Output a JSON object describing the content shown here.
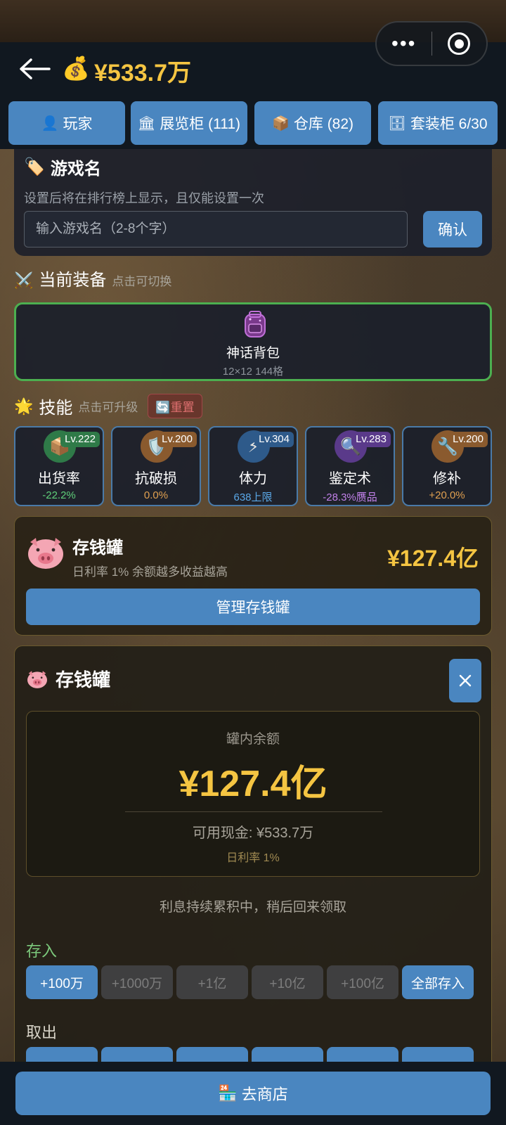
{
  "header": {
    "money_icon": "money-bag-icon",
    "money": "¥533.7万"
  },
  "tabs": [
    {
      "icon": "👤",
      "label": "玩家"
    },
    {
      "icon": "🏛",
      "label": "展览柜 (111)"
    },
    {
      "icon": "📦",
      "label": "仓库 (82)"
    },
    {
      "icon": "🗄",
      "label": "套装柜 6/30"
    }
  ],
  "name_card": {
    "icon": "🏷️",
    "title": "游戏名",
    "desc": "设置后将在排行榜上显示，且仅能设置一次",
    "input_placeholder": "输入游戏名（2-8个字）",
    "input_value": "",
    "confirm": "确认"
  },
  "equipment": {
    "icon": "⚔️",
    "title": "当前装备",
    "hint": "点击可切换",
    "item_name": "神话背包",
    "item_sub": "12×12 144格",
    "border_color": "#4caf50"
  },
  "skills_section": {
    "icon": "🌟",
    "title": "技能",
    "hint": "点击可升级",
    "reset": "🔄重置"
  },
  "skills": [
    {
      "icon": "box-icon",
      "glyph": "📦",
      "level": "Lv.222",
      "name": "出货率",
      "value": "-22.2%",
      "value_color": "#5fd07a",
      "icon_bg": "#2f7a48",
      "lv_bg": "#2f7a48"
    },
    {
      "icon": "shield-icon",
      "glyph": "🛡️",
      "level": "Lv.200",
      "name": "抗破损",
      "value": "0.0%",
      "value_color": "#e0a050",
      "icon_bg": "#8a5a2e",
      "lv_bg": "#8a5a2e"
    },
    {
      "icon": "lightning-icon",
      "glyph": "⚡",
      "level": "Lv.304",
      "name": "体力",
      "value": "638上限",
      "value_color": "#5aa8e8",
      "icon_bg": "#2e5a8a",
      "lv_bg": "#2e5a8a"
    },
    {
      "icon": "magnifier-icon",
      "glyph": "🔍",
      "level": "Lv.283",
      "name": "鉴定术",
      "value": "-28.3%赝品",
      "value_color": "#c080e8",
      "icon_bg": "#5a3a8a",
      "lv_bg": "#5a3a8a"
    },
    {
      "icon": "wrench-icon",
      "glyph": "🔧",
      "level": "Lv.200",
      "name": "修补",
      "value": "+20.0%",
      "value_color": "#e0a050",
      "icon_bg": "#8a5a2e",
      "lv_bg": "#8a5a2e"
    }
  ],
  "piggy_summary": {
    "title": "存钱罐",
    "rate": "日利率 1%  余额越多收益越高",
    "amount": "¥127.4亿",
    "manage": "管理存钱罐"
  },
  "piggy_panel": {
    "title": "存钱罐",
    "close": "close-icon",
    "balance_label": "罐内余额",
    "balance": "¥127.4亿",
    "cash": "可用现金: ¥533.7万",
    "daily_rate": "日利率 1%",
    "accumulating": "利息持续累积中，稍后回来领取",
    "deposit_label": "存入",
    "withdraw_label": "取出",
    "deposit_buttons": [
      {
        "label": "+100万",
        "enabled": true
      },
      {
        "label": "+1000万",
        "enabled": false
      },
      {
        "label": "+1亿",
        "enabled": false
      },
      {
        "label": "+10亿",
        "enabled": false
      },
      {
        "label": "+100亿",
        "enabled": false
      },
      {
        "label": "全部存入",
        "enabled": true
      }
    ]
  },
  "bottom": {
    "icon": "🏪",
    "shop": "去商店"
  }
}
